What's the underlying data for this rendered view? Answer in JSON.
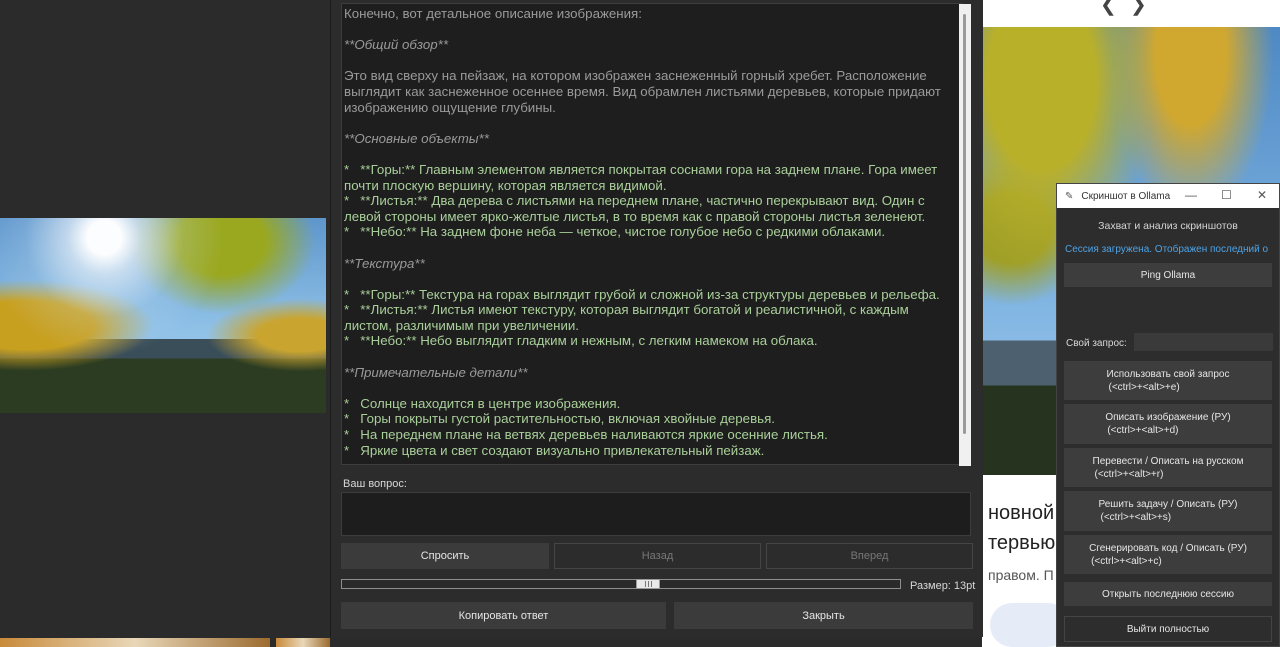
{
  "response": {
    "lines": [
      {
        "text": "Конечно, вот детальное описание изображения:",
        "style": "muted"
      },
      {
        "text": "",
        "style": ""
      },
      {
        "text": "**Общий обзор**",
        "style": "muted it"
      },
      {
        "text": "",
        "style": ""
      },
      {
        "text": "Это вид сверху на пейзаж, на котором изображен заснеженный горный хребет. Расположение выглядит как заснеженное осеннее время. Вид обрамлен листьями деревьев, которые придают изображению ощущение глубины.",
        "style": "muted"
      },
      {
        "text": "",
        "style": ""
      },
      {
        "text": "**Основные объекты**",
        "style": "muted it"
      },
      {
        "text": "",
        "style": ""
      },
      {
        "text": "*   **Горы:** Главным элементом является покрытая соснами гора на заднем плане. Гора имеет почти плоскую вершину, которая является видимой.",
        "style": ""
      },
      {
        "text": "*   **Листья:** Два дерева с листьями на переднем плане, частично перекрывают вид. Один с левой стороны имеет ярко-желтые листья, в то время как с правой стороны листья зеленеют.",
        "style": ""
      },
      {
        "text": "*   **Небо:** На заднем фоне неба — четкое, чистое голубое небо с редкими облаками.",
        "style": ""
      },
      {
        "text": "",
        "style": ""
      },
      {
        "text": "**Текстура**",
        "style": "muted it"
      },
      {
        "text": "",
        "style": ""
      },
      {
        "text": "*   **Горы:** Текстура на горах выглядит грубой и сложной из-за структуры деревьев и рельефа.",
        "style": ""
      },
      {
        "text": "*   **Листья:** Листья имеют текстуру, которая выглядит богатой и реалистичной, с каждым листом, различимым при увеличении.",
        "style": ""
      },
      {
        "text": "*   **Небо:** Небо выглядит гладким и нежным, с легким намеком на облака.",
        "style": ""
      },
      {
        "text": "",
        "style": ""
      },
      {
        "text": "**Примечательные детали**",
        "style": "muted it"
      },
      {
        "text": "",
        "style": ""
      },
      {
        "text": "*   Солнце находится в центре изображения.",
        "style": ""
      },
      {
        "text": "*   Горы покрыты густой растительностью, включая хвойные деревья.",
        "style": ""
      },
      {
        "text": "*   На переднем плане на ветвях деревьев наливаются яркие осенние листья.",
        "style": ""
      },
      {
        "text": "*   Яркие цвета и свет создают визуально привлекательный пейзаж.",
        "style": ""
      }
    ]
  },
  "question": {
    "label": "Ваш вопрос:",
    "value": "",
    "placeholder": ""
  },
  "nav": {
    "ask": "Спросить",
    "back": "Назад",
    "forward": "Вперед"
  },
  "font_size": {
    "label": "Размер: 13pt",
    "value_pt": 13,
    "slider_fraction": 0.55
  },
  "actions": {
    "copy": "Копировать ответ",
    "close": "Закрыть"
  },
  "mini": {
    "title": "Скриншот в Ollama",
    "heading": "Захват и анализ скриншотов",
    "status": "Сессия загружена. Отображен последний о",
    "ping": "Ping Ollama",
    "query_label": "Свой запрос:",
    "query_value": "",
    "buttons": [
      {
        "l1": "Использовать свой запрос",
        "l2": "(<ctrl>+<alt>+e)"
      },
      {
        "l1": "Описать изображение (РУ)",
        "l2": "(<ctrl>+<alt>+d)"
      },
      {
        "l1": "Перевести / Описать на русском",
        "l2": "(<ctrl>+<alt>+r)"
      },
      {
        "l1": "Решить задачу / Описать (РУ)",
        "l2": "(<ctrl>+<alt>+s)"
      },
      {
        "l1": "Сгенерировать код / Описать (РУ)",
        "l2": "(<ctrl>+<alt>+c)"
      }
    ],
    "open_last": "Открыть последнюю сессию",
    "quit": "Выйти полностью",
    "window_controls": {
      "minimize": "—",
      "maximize": "☐",
      "close": "✕"
    },
    "icon": "feather-icon"
  },
  "background": {
    "right_text_1": "новной",
    "right_text_2": "тервью",
    "right_text_3": "правом. П",
    "top_chevrons": [
      "❮",
      "❯"
    ]
  },
  "colors": {
    "response_green": "#a9cf9a",
    "response_muted": "#9a9a9a",
    "status_blue": "#4ea3e6",
    "button_bg": "#3b3b3b",
    "window_bg": "#2c2c2c"
  }
}
